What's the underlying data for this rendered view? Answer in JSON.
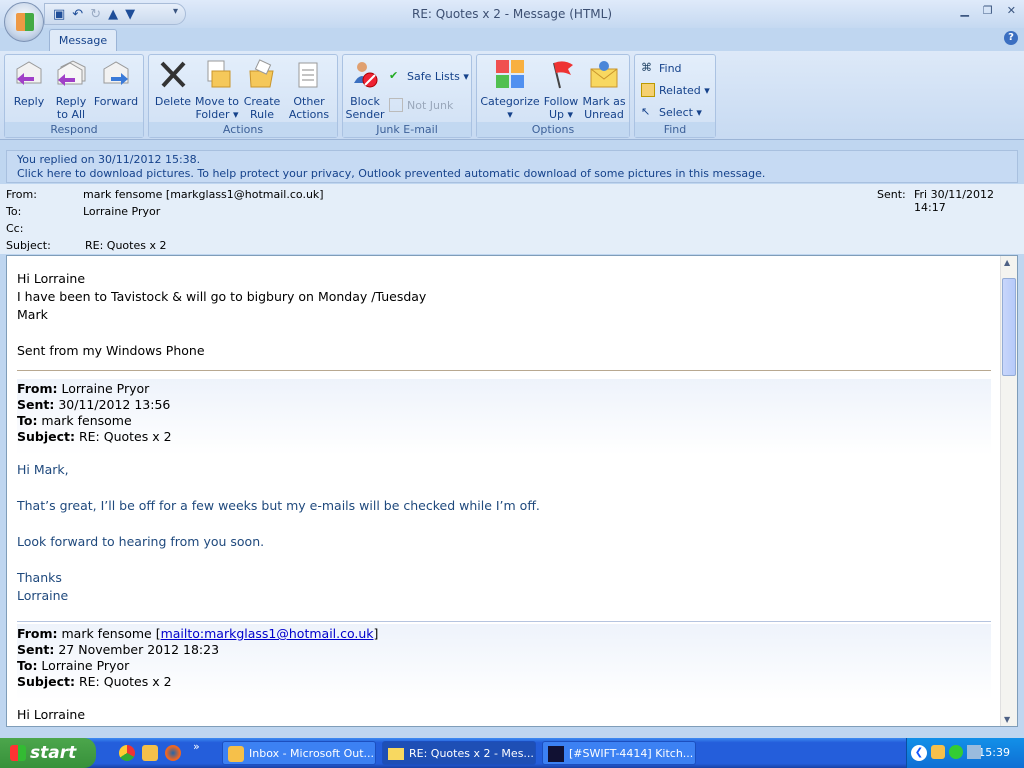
{
  "window": {
    "title": "RE: Quotes x 2 - Message (HTML)",
    "tab": "Message",
    "help": "?"
  },
  "ribbon": {
    "respond": {
      "label": "Respond",
      "reply": "Reply",
      "reply_all": [
        "Reply",
        "to All"
      ],
      "forward": "Forward"
    },
    "actions": {
      "label": "Actions",
      "delete": "Delete",
      "move": [
        "Move to",
        "Folder ▾"
      ],
      "rule": [
        "Create",
        "Rule"
      ],
      "other": [
        "Other",
        "Actions ▾"
      ]
    },
    "junk": {
      "label": "Junk E-mail",
      "block": [
        "Block",
        "Sender"
      ],
      "safe": "Safe Lists ▾",
      "notjunk": "Not Junk"
    },
    "options": {
      "label": "Options",
      "categorize": [
        "Categorize",
        "▾"
      ],
      "follow": [
        "Follow",
        "Up ▾"
      ],
      "mark": [
        "Mark as",
        "Unread"
      ]
    },
    "find": {
      "label": "Find",
      "find": "Find",
      "related": "Related ▾",
      "select": "Select ▾"
    }
  },
  "infobar": {
    "line1": "You replied on 30/11/2012 15:38.",
    "line2": "Click here to download pictures. To help protect your privacy, Outlook prevented automatic download of some pictures in this message."
  },
  "header": {
    "from_label": "From:",
    "from": "mark fensome [markglass1@hotmail.co.uk]",
    "sent_label": "Sent:",
    "sent": "Fri 30/11/2012 14:17",
    "to_label": "To:",
    "to": "Lorraine Pryor",
    "cc_label": "Cc:",
    "subject_label": "Subject:",
    "subject": "RE: Quotes x 2"
  },
  "body": {
    "reply": [
      "Hi Lorraine",
      "I have been to Tavistock  & will go to bigbury on Monday /Tuesday",
      "Mark",
      "",
      "Sent from my Windows Phone"
    ],
    "q1": {
      "from_l": "From:",
      "from": " Lorraine Pryor",
      "sent_l": "Sent:",
      "sent": " 30/11/2012 13:56",
      "to_l": "To:",
      "to": " mark fensome",
      "subj_l": "Subject:",
      "subj": " RE: Quotes x 2"
    },
    "q1_body": [
      "Hi Mark,",
      "That’s great, I’ll be off for a few weeks but my e-mails will be checked while I’m off.",
      "Look forward to hearing from you soon.",
      "Thanks",
      "Lorraine"
    ],
    "q2": {
      "from_l": "From:",
      "from": " mark fensome [",
      "mailto": "mailto:markglass1@hotmail.co.uk",
      "from_end": "]",
      "sent_l": "Sent:",
      "sent": " 27 November 2012 18:23",
      "to_l": "To:",
      "to": " Lorraine Pryor",
      "subj_l": "Subject:",
      "subj": " RE: Quotes x 2"
    },
    "q2_body": [
      "Hi Lorraine"
    ]
  },
  "taskbar": {
    "start": "start",
    "items": [
      "Inbox - Microsoft Out...",
      "RE: Quotes x 2 - Mes...",
      "[#SWIFT-4414] Kitch..."
    ],
    "clock": "15:39",
    "more": "»"
  }
}
